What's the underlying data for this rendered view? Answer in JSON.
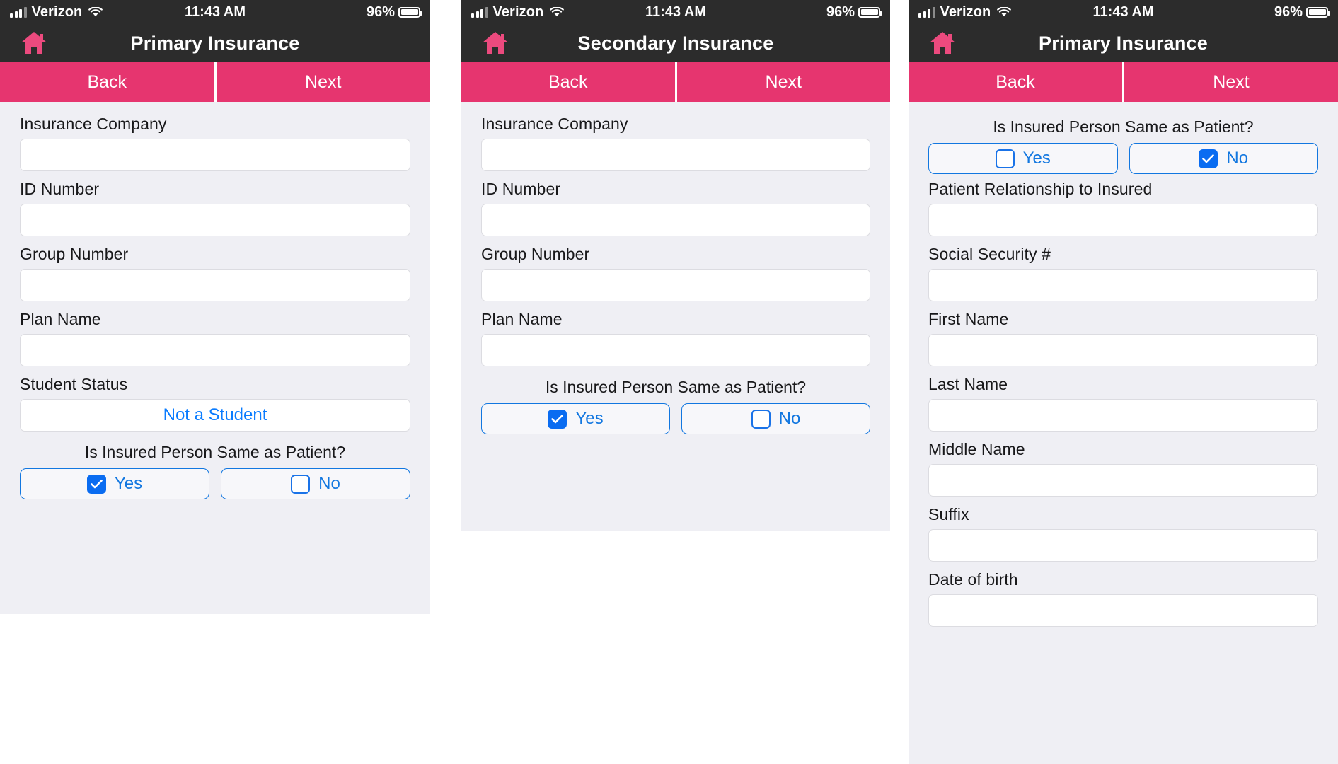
{
  "colors": {
    "status_bar": "#2c2c2c",
    "accent_pink": "#e6356f",
    "link_blue": "#1277e0",
    "checkbox_fill": "#0a6cf1",
    "page_background": "#efeff4"
  },
  "status_bar": {
    "carrier": "Verizon",
    "time": "11:43 AM",
    "battery_percent": "96%",
    "signal_icon": "signal-bars-icon",
    "wifi_icon": "wifi-icon",
    "battery_icon": "battery-icon"
  },
  "panels": [
    {
      "id": "primary-insurance",
      "nav": {
        "home_icon": "home-icon",
        "title": "Primary Insurance"
      },
      "actions": {
        "back": "Back",
        "next": "Next"
      },
      "fields": [
        {
          "label": "Insurance Company",
          "value": "",
          "type": "text"
        },
        {
          "label": "ID Number",
          "value": "",
          "type": "text"
        },
        {
          "label": "Group Number",
          "value": "",
          "type": "text"
        },
        {
          "label": "Plan Name",
          "value": "",
          "type": "text"
        },
        {
          "label": "Student Status",
          "value": "Not a Student",
          "type": "picker"
        }
      ],
      "question": {
        "label": "Is Insured Person Same as Patient?",
        "options": [
          {
            "label": "Yes",
            "checked": true
          },
          {
            "label": "No",
            "checked": false
          }
        ]
      }
    },
    {
      "id": "secondary-insurance",
      "nav": {
        "home_icon": "home-icon",
        "title": "Secondary Insurance"
      },
      "actions": {
        "back": "Back",
        "next": "Next"
      },
      "fields": [
        {
          "label": "Insurance Company",
          "value": "",
          "type": "text"
        },
        {
          "label": "ID Number",
          "value": "",
          "type": "text"
        },
        {
          "label": "Group Number",
          "value": "",
          "type": "text"
        },
        {
          "label": "Plan Name",
          "value": "",
          "type": "text"
        }
      ],
      "question": {
        "label": "Is Insured Person Same as Patient?",
        "options": [
          {
            "label": "Yes",
            "checked": true
          },
          {
            "label": "No",
            "checked": false
          }
        ]
      }
    },
    {
      "id": "primary-insurance-insured-details",
      "nav": {
        "home_icon": "home-icon",
        "title": "Primary Insurance"
      },
      "actions": {
        "back": "Back",
        "next": "Next"
      },
      "question": {
        "label": "Is Insured Person Same as Patient?",
        "options": [
          {
            "label": "Yes",
            "checked": false
          },
          {
            "label": "No",
            "checked": true
          }
        ]
      },
      "fields": [
        {
          "label": "Patient Relationship to Insured",
          "value": "",
          "type": "text"
        },
        {
          "label": "Social Security #",
          "value": "",
          "type": "text"
        },
        {
          "label": "First Name",
          "value": "",
          "type": "text"
        },
        {
          "label": "Last Name",
          "value": "",
          "type": "text"
        },
        {
          "label": "Middle Name",
          "value": "",
          "type": "text"
        },
        {
          "label": "Suffix",
          "value": "",
          "type": "text"
        },
        {
          "label": "Date of birth",
          "value": "",
          "type": "text"
        }
      ]
    }
  ]
}
